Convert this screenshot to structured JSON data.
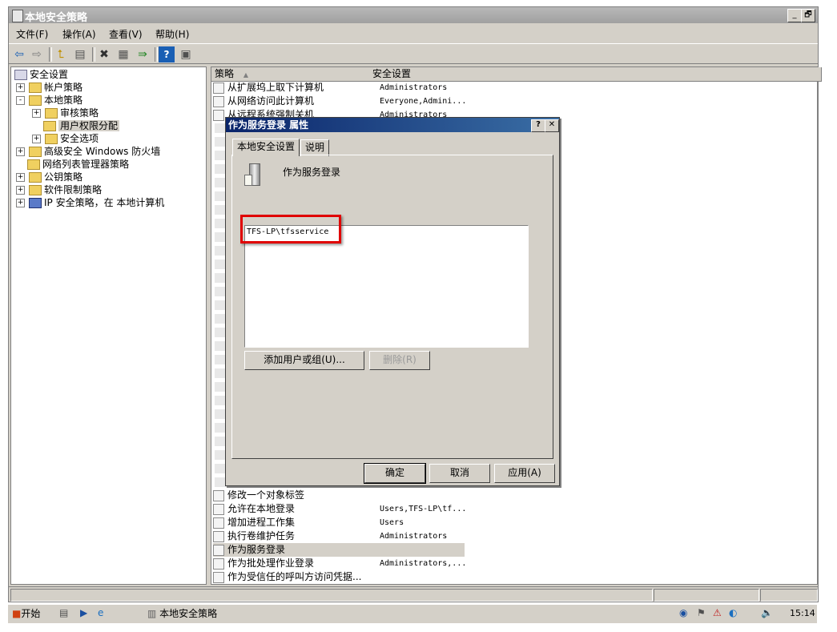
{
  "window": {
    "title": "本地安全策略",
    "caption_buttons": [
      "_",
      "🗗",
      "✕"
    ]
  },
  "menu": [
    "文件(F)",
    "操作(A)",
    "查看(V)",
    "帮助(H)"
  ],
  "toolbar_icons": [
    "back-arrow-icon",
    "forward-arrow-icon",
    "up-folder-icon",
    "show-hide-tree-icon",
    "delete-icon",
    "properties-icon",
    "export-list-icon",
    "help-icon",
    "console-icon"
  ],
  "tree": [
    {
      "label": "安全设置",
      "level": 0,
      "expander": ""
    },
    {
      "label": "帐户策略",
      "level": 1,
      "expander": "+"
    },
    {
      "label": "本地策略",
      "level": 1,
      "expander": "-"
    },
    {
      "label": "审核策略",
      "level": 2,
      "expander": "+"
    },
    {
      "label": "用户权限分配",
      "level": 2,
      "expander": "",
      "selected": true
    },
    {
      "label": "安全选项",
      "level": 2,
      "expander": "+"
    },
    {
      "label": "高级安全 Windows 防火墙",
      "level": 1,
      "expander": "+"
    },
    {
      "label": "网络列表管理器策略",
      "level": 1,
      "expander": ""
    },
    {
      "label": "公钥策略",
      "level": 1,
      "expander": "+"
    },
    {
      "label": "软件限制策略",
      "level": 1,
      "expander": "+"
    },
    {
      "label": "IP 安全策略，在 本地计算机",
      "level": 1,
      "expander": "+"
    }
  ],
  "list": {
    "columns": [
      "策略",
      "安全设置"
    ],
    "sort_indicator": "▲",
    "top_rows": [
      {
        "name": "从扩展坞上取下计算机",
        "setting": "Administrators"
      },
      {
        "name": "从网络访问此计算机",
        "setting": "Everyone,Admini..."
      },
      {
        "name": "从远程系统强制关机",
        "setting": "Administrators"
      }
    ],
    "bottom_rows": [
      {
        "name": "修改一个对象标签",
        "setting": ""
      },
      {
        "name": "允许在本地登录",
        "setting": "Users,TFS-LP\\tf..."
      },
      {
        "name": "增加进程工作集",
        "setting": "Users"
      },
      {
        "name": "执行卷维护任务",
        "setting": "Administrators"
      },
      {
        "name": "作为服务登录",
        "setting": "",
        "selected": true
      },
      {
        "name": "作为批处理作业登录",
        "setting": "Administrators,..."
      },
      {
        "name": "作为受信任的呼叫方访问凭据...",
        "setting": ""
      }
    ]
  },
  "dialog": {
    "title": "作为服务登录 属性",
    "help_btn": "?",
    "close_btn": "✕",
    "tabs": [
      "本地安全设置",
      "说明"
    ],
    "policy_name": "作为服务登录",
    "accounts": [
      "TFS-LP\\tfsservice"
    ],
    "add_button": "添加用户或组(U)...",
    "remove_button": "删除(R)",
    "ok_button": "确定",
    "cancel_button": "取消",
    "apply_button": "应用(A)",
    "highlight_color": "#e00000"
  },
  "taskbar": {
    "start_label": "开始",
    "task_label": "本地安全策略",
    "clock": "15:14"
  },
  "colors": {
    "titlebar_inactive": "#a8a8a8",
    "dialog_titlebar": "#0a246a",
    "selection": "#d4d0c8"
  }
}
